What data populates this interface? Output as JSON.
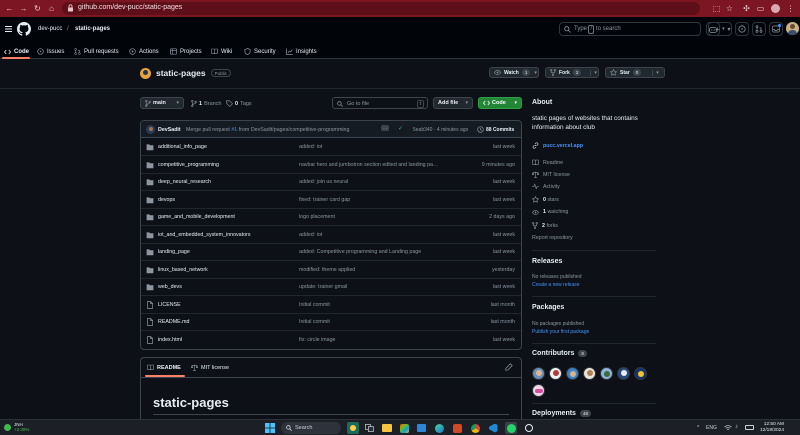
{
  "browser": {
    "url": "github.com/dev-pucc/static-pages"
  },
  "header": {
    "owner": "dev-pucc",
    "separator": "/",
    "repo": "static-pages",
    "search_prefix": "Type",
    "search_key": "/",
    "search_suffix": "to search",
    "plus_label": "+",
    "tabs": [
      {
        "label": "Code",
        "icon": "code-icon"
      },
      {
        "label": "Issues",
        "icon": "issue-icon"
      },
      {
        "label": "Pull requests",
        "icon": "pull-request-icon"
      },
      {
        "label": "Actions",
        "icon": "play-icon"
      },
      {
        "label": "Projects",
        "icon": "table-icon"
      },
      {
        "label": "Wiki",
        "icon": "book-icon"
      },
      {
        "label": "Security",
        "icon": "shield-icon"
      },
      {
        "label": "Insights",
        "icon": "graph-icon"
      }
    ]
  },
  "repo": {
    "name": "static-pages",
    "visibility": "Public",
    "watch_label": "Watch",
    "watch_count": "1",
    "fork_label": "Fork",
    "fork_count": "2",
    "star_label": "Star",
    "star_count": "0"
  },
  "toolbar": {
    "branch": "main",
    "branches_count": "1",
    "branches_label": "Branch",
    "tags_count": "0",
    "tags_label": "Tags",
    "goto_placeholder": "Go to file",
    "goto_key": "t",
    "add_file_label": "Add file",
    "code_label": "Code"
  },
  "commit": {
    "author": "DevSadit",
    "message_prefix": "Merge pull request",
    "pr": "#1",
    "message_suffix": "from DevSadit/pages/competitive-programming",
    "ellipsis": "...",
    "sha_time": "5eab340 · 4 minutes ago",
    "commits_label": "88 Commits"
  },
  "files": [
    {
      "name": "additional_info_page",
      "type": "dir",
      "message": "added: iot",
      "date": "last week"
    },
    {
      "name": "competitive_programming",
      "type": "dir",
      "message": "navbar hero and jumbotron section edited and landing pa…",
      "date": "9 minutes ago"
    },
    {
      "name": "deep_neural_research",
      "type": "dir",
      "message": "added: join us neural",
      "date": "last week"
    },
    {
      "name": "devops",
      "type": "dir",
      "message": "fixed: trainer card gap",
      "date": "last week"
    },
    {
      "name": "game_and_mobile_development",
      "type": "dir",
      "message": "logo placement",
      "date": "2 days ago"
    },
    {
      "name": "iot_and_embedded_system_innovators",
      "type": "dir",
      "message": "added: iot",
      "date": "last week"
    },
    {
      "name": "landing_page",
      "type": "dir",
      "message": "added: Competitive programming and Landing page",
      "date": "last week"
    },
    {
      "name": "linux_based_network",
      "type": "dir",
      "message": "modified: theme applied",
      "date": "yesterday"
    },
    {
      "name": "web_devs",
      "type": "dir",
      "message": "update: trainer gmail",
      "date": "last week"
    },
    {
      "name": "LICENSE",
      "type": "file",
      "message": "Initial commit",
      "date": "last month"
    },
    {
      "name": "README.md",
      "type": "file",
      "message": "Initial commit",
      "date": "last month"
    },
    {
      "name": "index.html",
      "type": "file",
      "message": "fix: circle image",
      "date": "last week"
    }
  ],
  "readme": {
    "tab_readme": "README",
    "tab_license": "MIT license",
    "heading": "static-pages"
  },
  "about": {
    "heading": "About",
    "description": "static pages of websites that contains information about club",
    "link": "pucc.vercel.app",
    "readme": "Readme",
    "license": "MIT license",
    "activity": "Activity",
    "stars_count": "0",
    "stars_label": "stars",
    "watching_count": "1",
    "watching_label": "watching",
    "forks_count": "2",
    "forks_label": "forks",
    "report": "Report repository"
  },
  "releases": {
    "heading": "Releases",
    "none": "No releases published",
    "create": "Create a new release"
  },
  "packages": {
    "heading": "Packages",
    "none": "No packages published",
    "publish": "Publish your first package"
  },
  "contributors": {
    "heading": "Contributors",
    "count": "8"
  },
  "deployments": {
    "heading": "Deployments",
    "count": "48"
  },
  "taskbar": {
    "weather_label": "JNH",
    "weather_change": "+3.39%",
    "search_label": "Search",
    "time": "12:50 AM",
    "date": "12/19/2024",
    "lang": "ENG"
  },
  "colors": {
    "accent": "#4493f8",
    "green": "#238636",
    "chrome": "#7b1622"
  }
}
